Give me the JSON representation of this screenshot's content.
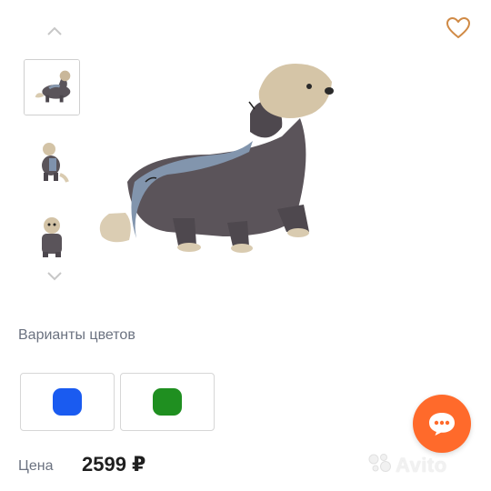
{
  "gallery": {
    "thumbnail_count": 3,
    "selected_index": 0,
    "icons": {
      "prev": "chevron-up-icon",
      "next": "chevron-down-icon",
      "favorite": "heart-icon"
    }
  },
  "variants": {
    "title": "Варианты цветов",
    "options": [
      {
        "color": "#1a5bf0"
      },
      {
        "color": "#1f8f20"
      }
    ]
  },
  "price": {
    "label": "Цена",
    "value": "2599 ₽"
  },
  "chat": {
    "icon": "chat-bubble-icon",
    "color": "#ff6a2b"
  },
  "watermark": {
    "text": "Avito"
  }
}
